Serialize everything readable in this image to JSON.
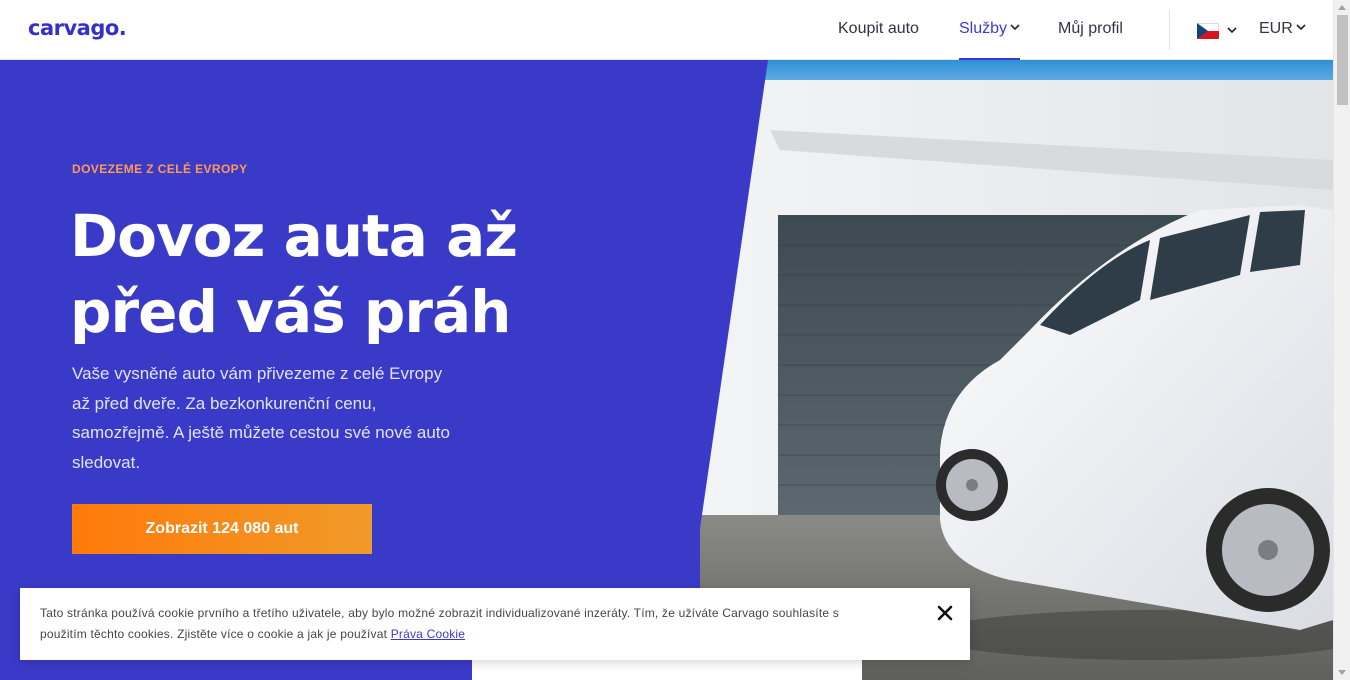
{
  "header": {
    "logo": "carvago.",
    "nav": {
      "buy": "Koupit auto",
      "services": "Služby",
      "profile": "Můj profil"
    },
    "currency": "EUR",
    "language_flag": "czech-flag-icon"
  },
  "hero": {
    "eyebrow": "DOVEZEME Z CELÉ EVROPY",
    "title_line1": "Dovoz auta až",
    "title_line2": "před váš práh",
    "subtitle_line1": "Vaše vysněné auto vám přivezeme z celé Evropy",
    "subtitle_line2": "až před dveře. Za bezkonkurenční cenu,",
    "subtitle_line3": "samozřejmě. A ještě můžete cestou své nové auto",
    "subtitle_line4": "sledovat.",
    "cta_label": "Zobrazit 124 080 aut"
  },
  "cookie": {
    "text_line1": "Tato stránka používá cookie prvního a třetího uživatele, aby bylo možné zobrazit individualizované inzeráty. Tím, že užíváte Carvago souhlasíte s",
    "text_line2": "použitím těchto cookies. Zjistěte více o cookie a jak je používat ",
    "link": "Práva Cookie"
  },
  "colors": {
    "brand_blue": "#3a3ac9",
    "cta_orange": "#ff7a0a",
    "eyebrow_orange": "#ff9a55"
  }
}
